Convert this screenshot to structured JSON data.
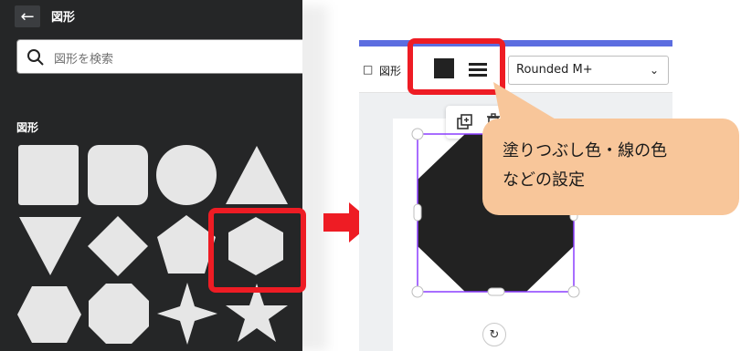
{
  "left_panel": {
    "title": "図形",
    "search_placeholder": "図形を検索",
    "section_title": "図形",
    "shapes": [
      "square",
      "rounded-square",
      "circle",
      "triangle",
      "inverted-triangle",
      "diamond",
      "pentagon",
      "hexagon",
      "hexagon-flat",
      "octagon",
      "four-point-star",
      "five-point-star"
    ],
    "highlighted_shape": "hexagon",
    "shape_color": "#e6e6e6"
  },
  "editor": {
    "toolbar_label": "図形",
    "fill_color": "#222222",
    "font_name": "Rounded M+",
    "accent_color": "#5c6de0"
  },
  "callout": {
    "line1": "塗りつぶし色・線の色",
    "line2": "などの設定",
    "color": "#f8c69a"
  },
  "highlight_color": "#ee1c24"
}
